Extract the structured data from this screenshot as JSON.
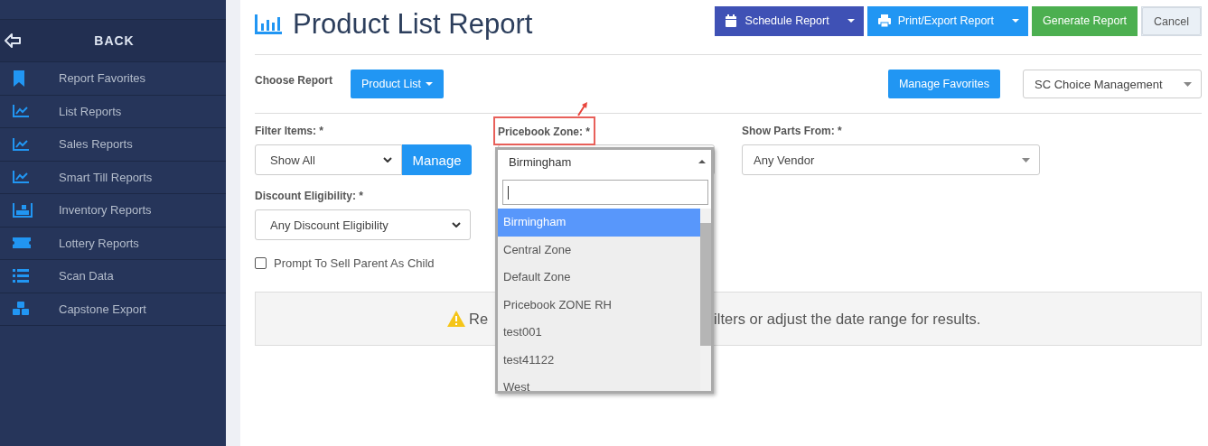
{
  "sidebar": {
    "back_label": "BACK",
    "items": [
      {
        "label": "Report Favorites"
      },
      {
        "label": "List Reports"
      },
      {
        "label": "Sales Reports"
      },
      {
        "label": "Smart Till Reports"
      },
      {
        "label": "Inventory Reports"
      },
      {
        "label": "Lottery Reports"
      },
      {
        "label": "Scan Data"
      },
      {
        "label": "Capstone Export"
      }
    ]
  },
  "header": {
    "title": "Product List Report",
    "buttons": [
      {
        "label": "Schedule Report",
        "kind": "schedule",
        "caret": true
      },
      {
        "label": "Print/Export Report",
        "kind": "print",
        "caret": true
      },
      {
        "label": "Generate Report",
        "kind": "generate",
        "caret": false
      },
      {
        "label": "Cancel",
        "kind": "cancel",
        "caret": false
      }
    ]
  },
  "report_bar": {
    "label": "Choose Report",
    "report_button": "Product List",
    "favorites_button": "Manage Favorites",
    "store_select": "SC Choice Management"
  },
  "filters": {
    "filter_items": {
      "label": "Filter Items: *",
      "value": "Show All",
      "button": "Manage"
    },
    "pricebook_zone": {
      "label": "Pricebook Zone: *",
      "value": "Birmingham",
      "expanded": true,
      "options": [
        {
          "label": "Birmingham",
          "selected": true
        },
        {
          "label": "Central Zone",
          "selected": false
        },
        {
          "label": "Default Zone",
          "selected": false
        },
        {
          "label": "Pricebook ZONE RH",
          "selected": false
        },
        {
          "label": "test001",
          "selected": false
        },
        {
          "label": "test41122",
          "selected": false
        },
        {
          "label": "West",
          "selected": false
        }
      ]
    },
    "show_parts_from": {
      "label": "Show Parts From: *",
      "value": "Any Vendor"
    },
    "discount_eligibility": {
      "label": "Discount Eligibility: *",
      "value": "Any Discount Eligibility"
    },
    "prompt_checkbox": {
      "label": "Prompt To Sell Parent As Child",
      "checked": false
    }
  },
  "alert": {
    "parts": [
      "Re",
      "ilters or adjust the date range for results."
    ]
  }
}
